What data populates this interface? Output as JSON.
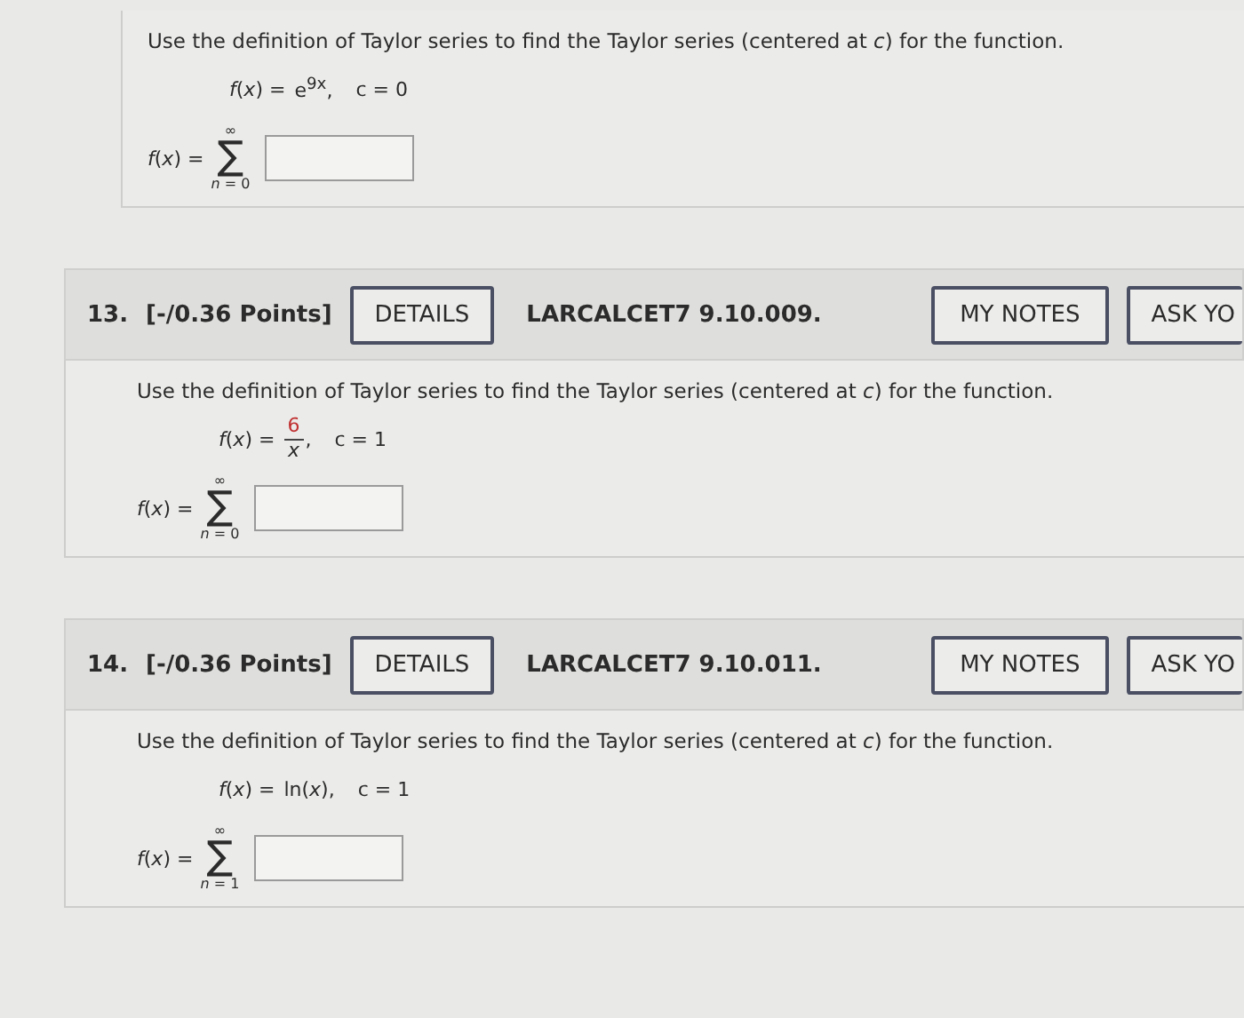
{
  "questions": [
    {
      "prompt": "Use the definition of Taylor series to find the Taylor series (centered at *c*) for the function.",
      "function": {
        "kind": "power",
        "lhs": "*f*(*x*) =",
        "expression": "e$^{9x}$,",
        "center": "c = 0"
      },
      "sum": {
        "lhs": "*f*(*x*) =",
        "sigma": "∑",
        "upper": "∞",
        "lower": "*n* = 0"
      }
    },
    {
      "header": {
        "number": "13.",
        "points": "[-/0.36 Points]",
        "details": "DETAILS",
        "code": "LARCALCET7 9.10.009.",
        "notes": "MY NOTES",
        "ask": "ASK YO"
      },
      "prompt": "Use the definition of Taylor series to find the Taylor series (centered at *c*) for the function.",
      "function": {
        "kind": "fraction",
        "lhs": "*f*(*x*) =",
        "numerator": "6",
        "denominator": "*x*",
        "separator": ",",
        "center": "c = 1"
      },
      "sum": {
        "lhs": "*f*(*x*) =",
        "sigma": "∑",
        "upper": "∞",
        "lower": "*n* = 0"
      }
    },
    {
      "header": {
        "number": "14.",
        "points": "[-/0.36 Points]",
        "details": "DETAILS",
        "code": "LARCALCET7 9.10.011.",
        "notes": "MY NOTES",
        "ask": "ASK YO"
      },
      "prompt": "Use the definition of Taylor series to find the Taylor series (centered at *c*) for the function.",
      "function": {
        "kind": "power",
        "lhs": "*f*(*x*) =",
        "expression": "ln(*x*),",
        "center": "c = 1"
      },
      "sum": {
        "lhs": "*f*(*x*) =",
        "sigma": "∑",
        "upper": "∞",
        "lower": "*n* = 1"
      }
    }
  ]
}
